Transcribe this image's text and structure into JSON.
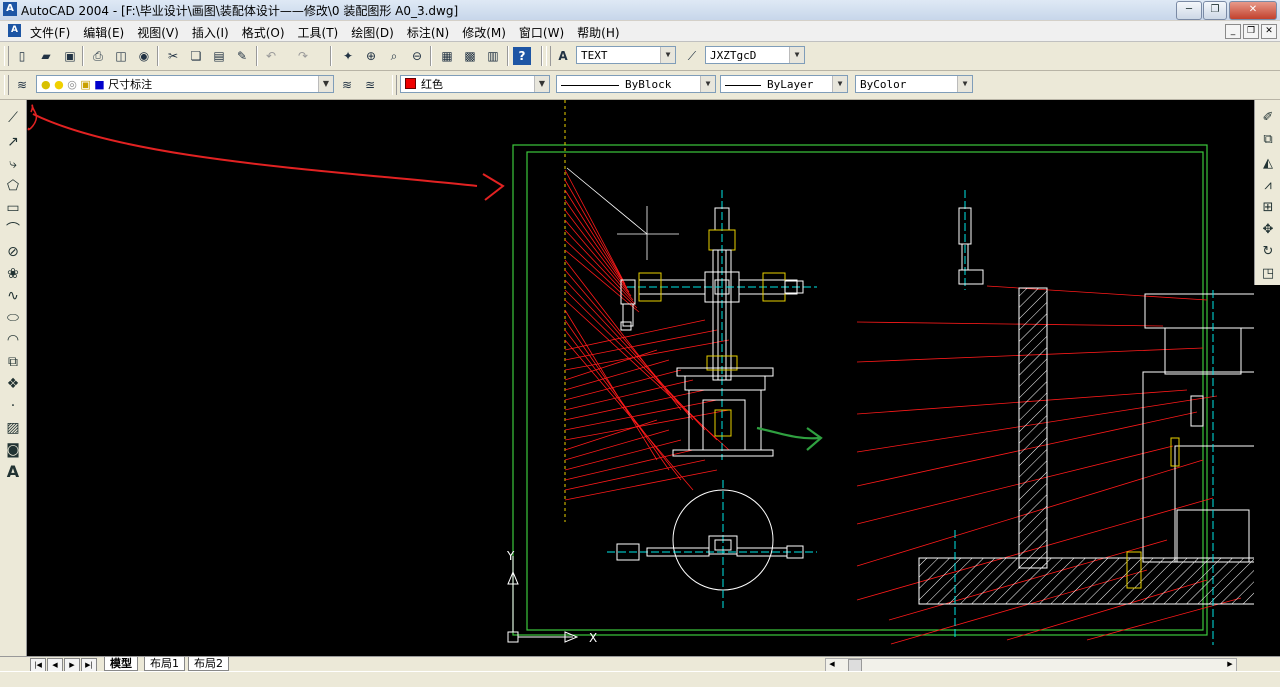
{
  "window": {
    "title": "AutoCAD 2004 - [F:\\毕业设计\\画图\\装配体设计——修改\\0 装配图形 A0_3.dwg]",
    "app_icon": "A"
  },
  "menu": {
    "items": [
      "文件(F)",
      "编辑(E)",
      "视图(V)",
      "插入(I)",
      "格式(O)",
      "工具(T)",
      "绘图(D)",
      "标注(N)",
      "修改(M)",
      "窗口(W)",
      "帮助(H)"
    ]
  },
  "styles": {
    "text_style": "TEXT",
    "dim_style": "JXZTgcD"
  },
  "layers": {
    "current": "尺寸标注"
  },
  "properties": {
    "color": "红色",
    "color_hex": "#e00000",
    "linetype": "ByBlock",
    "lineweight": "ByLayer",
    "plotstyle": "ByColor"
  },
  "layout_tabs": [
    "模型",
    "布局1",
    "布局2"
  ],
  "active_tab": "模型",
  "ucs": {
    "x_label": "X",
    "y_label": "Y"
  },
  "colors": {
    "annotation_red": "#e22222",
    "annotation_green": "#2fa040",
    "frame_green": "#3cc83c",
    "leader_red": "#ff1a1a",
    "geometry_white": "#ffffff",
    "center_cyan": "#00e6e6",
    "canvas_bg": "#000000"
  }
}
